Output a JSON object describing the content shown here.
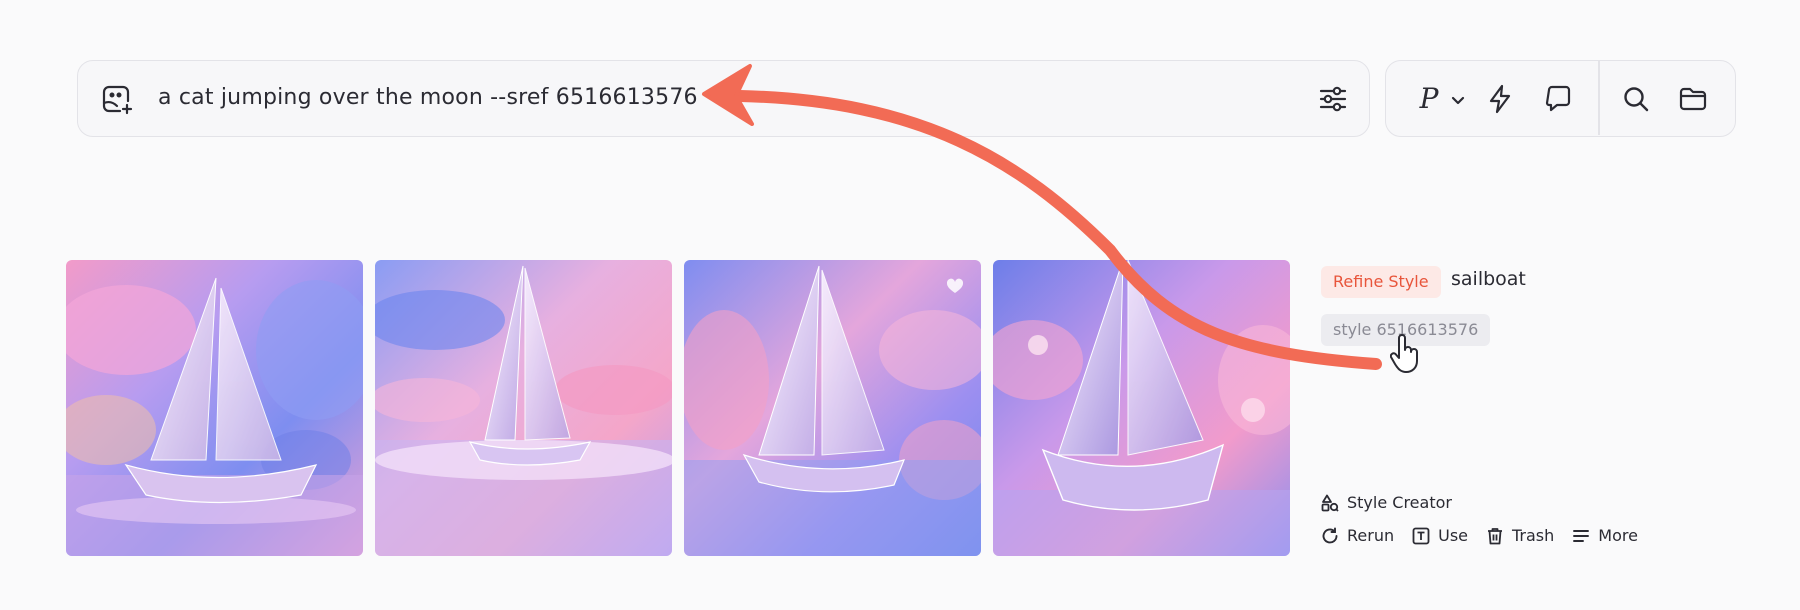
{
  "prompt": {
    "text": "a cat jumping over the moon --sref 6516613576"
  },
  "toolbar": {
    "personalize_label": "P"
  },
  "images": [
    {
      "alt": "sailboat image 1"
    },
    {
      "alt": "sailboat image 2"
    },
    {
      "alt": "sailboat image 3"
    },
    {
      "alt": "sailboat image 4"
    }
  ],
  "side": {
    "refine_label": "Refine Style",
    "subject": "sailboat",
    "style_chip": "style 6516613576",
    "style_creator": "Style Creator",
    "actions": {
      "rerun": "Rerun",
      "use": "Use",
      "trash": "Trash",
      "more": "More"
    }
  },
  "colors": {
    "accent": "#e8553b",
    "arrow": "#f26b55",
    "background": "#fafafb"
  },
  "icons": [
    "image-add-icon",
    "sliders-icon",
    "chevron-down-icon",
    "lightning-icon",
    "chat-icon",
    "search-icon",
    "folder-icon",
    "heart-icon",
    "hand-pointer-icon",
    "style-creator-icon",
    "rerun-icon",
    "use-icon",
    "trash-icon",
    "more-icon"
  ]
}
